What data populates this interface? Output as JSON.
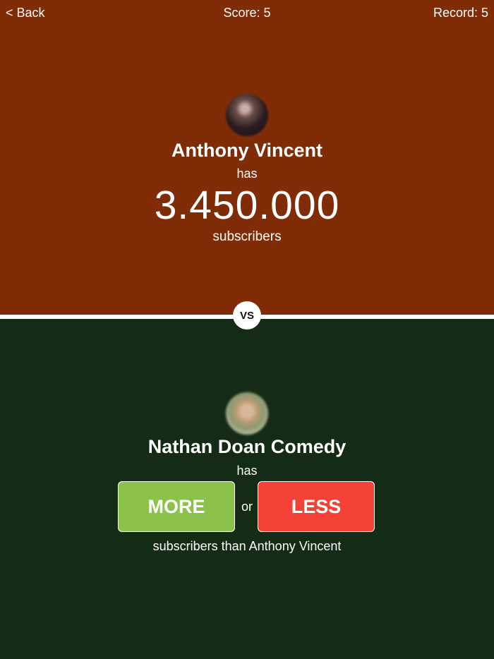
{
  "header": {
    "back_label": "< Back",
    "score_label": "Score: 5",
    "record_label": "Record: 5"
  },
  "current": {
    "name": "Anthony Vincent",
    "has_label": "has",
    "subscribers": "3.450.000",
    "unit_label": "subscribers"
  },
  "vs_label": "VS",
  "challenger": {
    "name": "Nathan Doan Comedy",
    "has_label": "has",
    "more_label": "MORE",
    "or_label": "or",
    "less_label": "LESS",
    "comparison_text": "subscribers than Anthony Vincent"
  },
  "colors": {
    "top_background": "#802c06",
    "bottom_background": "#142b16",
    "more_button": "#8bc34a",
    "less_button": "#f44336"
  }
}
